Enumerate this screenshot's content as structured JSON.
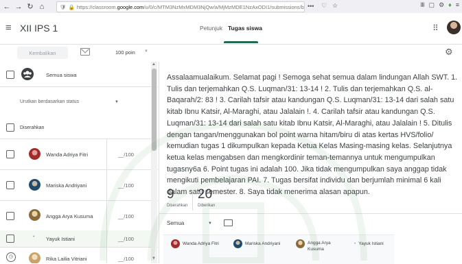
{
  "browser": {
    "url_prefix": "https://classroom.",
    "url_domain": "google.com",
    "url_rest": "/u/0/c/MTM3NzMxMDM3NjQw/a/MjMzMDE1NzAxODI1/submissions/by-status/and",
    "more": "•••"
  },
  "header": {
    "class_title": "XII IPS 1",
    "tabs": [
      {
        "label": "Petunjuk"
      },
      {
        "label": "Tugas siswa"
      }
    ]
  },
  "toolbar": {
    "return_label": "Kembalikan",
    "points_value": "100 poin"
  },
  "list": {
    "select_all_label": "Semua siswa",
    "sort_label": "Urutkan berdasarkan status",
    "section_label": "Diserahkan",
    "students": [
      {
        "name": "Wanda Adriya Fitri",
        "grade": "__/100"
      },
      {
        "name": "Mariska Andriyani",
        "grade": "__/100"
      },
      {
        "name": "Angga Arya Kusuma",
        "grade": "__/100"
      },
      {
        "name": "Yayuk Istiani",
        "grade": "__/100"
      },
      {
        "name": "Rika Lailia Vitriani",
        "grade": "__/100"
      }
    ]
  },
  "instructions": "Assalaamualaikum. Selamat pagi ! Semoga sehat semua dalam lindungan Allah SWT. 1. Tulis dan terjemahkan Q.S. Luqman/31: 13-14 ! 2. Tulis dan terjemahkan Q.S. al-Baqarah/2: 83 ! 3. Carilah tafsir atau kandungan Q.S. Luqman/31: 13-14 dari salah satu kitab Ibnu Katsir, Al-Maraghi, atau Jalalain !. 4. Carilah tafsir atau kandungan Q.S. Luqman/31: 13-14 dari salah satu kitab Ibnu Katsir, Al-Maraghi, atau Jalalain ! 5. Ditulis dengan tangan/menggunakan bol point warna hitam/biru di atas kertas HVS/folio/ kemudian tugas 1 dikumpulkan kepada Ketua Kelas Masing-masing kelas. Selanjutnya ketua kelas mengabsen dan mengkordinir teman-temannya untuk mengumpulkan tugasny6a 6. Point tugas ini adalah 100. Jika tidak mengumpulkan saya anggap tidak mengikuti pembelajaran PAI. 7. Tugas bersifat individu dan berjumlah minimal 6 kali dalam satu semester. 8. Saya tidak menerima alasan apapun.",
  "stats": {
    "turned_in_count": "9",
    "turned_in_label": "Diserahkan",
    "assigned_count": "20",
    "assigned_label": "Diberikan"
  },
  "filter": {
    "value": "Semua"
  },
  "cards": [
    {
      "name": "Wanda Adriya Fitri"
    },
    {
      "name": "Mariska Andriyani"
    },
    {
      "name": "Angga Arya Kusuma"
    },
    {
      "name": "Yayuk Istiani"
    }
  ],
  "colors": {
    "accent": "#1e6b52",
    "watermark": "#2e7d32"
  }
}
